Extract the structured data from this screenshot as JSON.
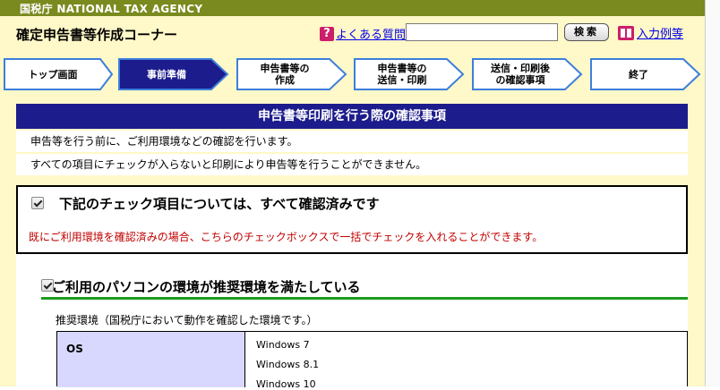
{
  "agency": "国税庁 NATIONAL TAX AGENCY",
  "header": {
    "app_title": "確定申告書等作成コーナー",
    "faq_icon": "?",
    "faq_label": "よくある質問",
    "search_value": "",
    "search_button": "検索",
    "examples_label": "入力例等"
  },
  "steps": [
    {
      "label": "トップ画面",
      "active": false
    },
    {
      "label": "事前準備",
      "active": true
    },
    {
      "label": "申告書等の\n作成",
      "active": false
    },
    {
      "label": "申告書等の\n送信・印刷",
      "active": false
    },
    {
      "label": "送信・印刷後\nの確認事項",
      "active": false
    },
    {
      "label": "終了",
      "active": false
    }
  ],
  "section": {
    "title": "申告書等印刷を行う際の確認事項",
    "line1": "申告等を行う前に、ご利用環境などの確認を行います。",
    "line2": "すべての項目にチェックが入らないと印刷により申告等を行うことができません。"
  },
  "confirm_all": {
    "checked": true,
    "title": "下記のチェック項目については、すべて確認済みです",
    "note": "既にご利用環境を確認済みの場合、こちらのチェックボックスで一括でチェックを入れることができます。"
  },
  "environment": {
    "checked": true,
    "title": "ご利用のパソコンの環境が推奨環境を満たしている",
    "desc": "推奨環境（国税庁において動作を確認した環境です。）",
    "os_label": "OS",
    "os_list": [
      "Windows 7",
      "Windows 8.1",
      "Windows 10"
    ]
  },
  "colors": {
    "agency_band": "#7a8a1e",
    "header_bg": "#fff8c8",
    "section_header": "#1c1c8c",
    "active_step": "#1c1c8c",
    "step_border": "#3d7fdc",
    "note_red": "#c00000",
    "rule_green": "#1e9a1e",
    "table_label": "#d8d8ff",
    "pink_icon": "#cc1f6a"
  }
}
